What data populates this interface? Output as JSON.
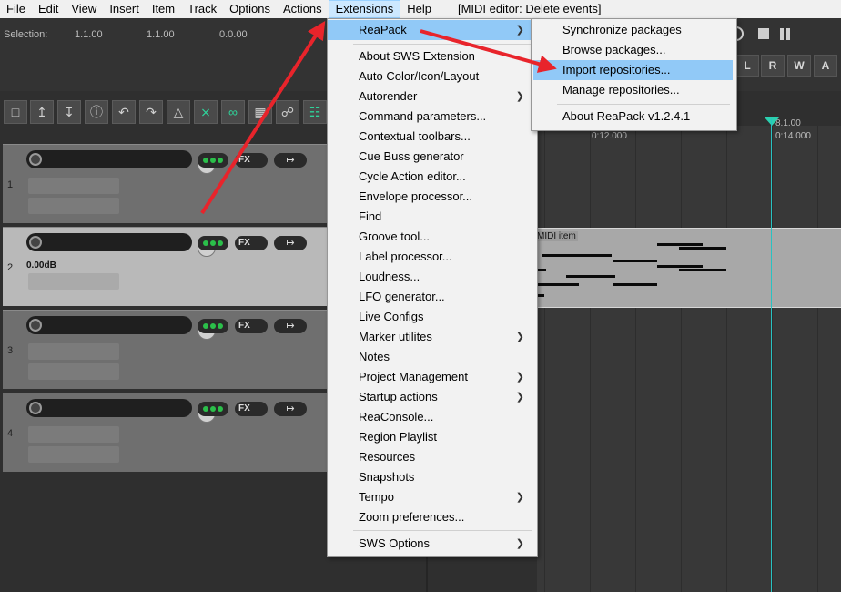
{
  "menubar": {
    "items": [
      "File",
      "Edit",
      "View",
      "Insert",
      "Item",
      "Track",
      "Options",
      "Actions",
      "Extensions",
      "Help"
    ],
    "active": "Extensions",
    "window_title": "[MIDI editor: Delete events]"
  },
  "info": {
    "selection_label": "Selection:",
    "sel_start": "1.1.00",
    "sel_end": "1.1.00",
    "sel_length": "0.0.00"
  },
  "transport": {
    "buttons": [
      "L",
      "R",
      "W",
      "A"
    ]
  },
  "timeline": {
    "labels": [
      "0:12.000",
      "0:14.000"
    ],
    "marker": "8.1.00"
  },
  "tracks": [
    {
      "number": "1",
      "volume": ""
    },
    {
      "number": "2",
      "volume": "0.00dB"
    },
    {
      "number": "3",
      "volume": ""
    },
    {
      "number": "4",
      "volume": ""
    }
  ],
  "track_labels": {
    "fx": "FX"
  },
  "midi_item": {
    "label": "MIDI item"
  },
  "extensions_menu": {
    "items": [
      {
        "label": "ReaPack",
        "submenu": true,
        "highlight": true
      },
      {
        "label": "About SWS Extension"
      },
      {
        "label": "Auto Color/Icon/Layout"
      },
      {
        "label": "Autorender",
        "submenu": true
      },
      {
        "label": "Command parameters..."
      },
      {
        "label": "Contextual toolbars..."
      },
      {
        "label": "Cue Buss generator"
      },
      {
        "label": "Cycle Action editor..."
      },
      {
        "label": "Envelope processor..."
      },
      {
        "label": "Find"
      },
      {
        "label": "Groove tool..."
      },
      {
        "label": "Label processor..."
      },
      {
        "label": "Loudness..."
      },
      {
        "label": "LFO generator..."
      },
      {
        "label": "Live Configs"
      },
      {
        "label": "Marker utilites",
        "submenu": true
      },
      {
        "label": "Notes"
      },
      {
        "label": "Project Management",
        "submenu": true
      },
      {
        "label": "Startup actions",
        "submenu": true
      },
      {
        "label": "ReaConsole..."
      },
      {
        "label": "Region Playlist"
      },
      {
        "label": "Resources"
      },
      {
        "label": "Snapshots"
      },
      {
        "label": "Tempo",
        "submenu": true
      },
      {
        "label": "Zoom preferences..."
      },
      {
        "label": "SWS Options",
        "submenu": true
      }
    ]
  },
  "reapack_menu": {
    "items": [
      {
        "label": "Synchronize packages"
      },
      {
        "label": "Browse packages..."
      },
      {
        "label": "Import repositories...",
        "highlight": true
      },
      {
        "label": "Manage repositories..."
      },
      {
        "label": "About ReaPack v1.2.4.1"
      }
    ]
  },
  "colors": {
    "menu_highlight": "#91c9f7",
    "annotation_arrow": "#e8242b",
    "playhead": "#28c2c2",
    "active_led": "#2bbf4a"
  },
  "icons": [
    "new-project-icon",
    "upload-icon",
    "download-icon",
    "info-icon",
    "undo-icon",
    "redo-icon",
    "metronome-icon",
    "crossfade-icon",
    "link-icon",
    "grid-icon",
    "group-icon",
    "snap-icon",
    "record-icon",
    "stop-icon",
    "pause-icon",
    "knob-icon",
    "route-icon"
  ]
}
